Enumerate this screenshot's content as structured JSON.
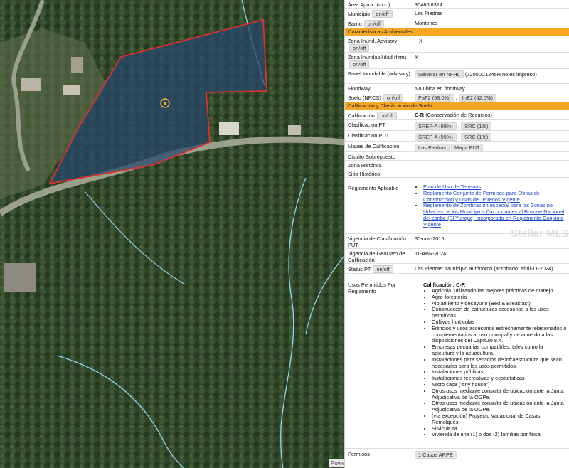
{
  "map": {
    "credit": "Powe",
    "colors": {
      "forest": "#2f4528",
      "parcel_fill": "#27466e",
      "parcel_stroke": "#e0302e",
      "stream": "#8fd6f2",
      "road": "#9aa08c"
    }
  },
  "watermark": "Stellar MLS",
  "rows": {
    "area": {
      "label": "Área Aprox. (m.c.)",
      "value": "30466.8314"
    },
    "municipio": {
      "label": "Municipio",
      "btn": "on/off",
      "value": "Las Piedras"
    },
    "barrio": {
      "label": "Barrio",
      "btn": "on/off",
      "value": "Montones"
    },
    "section_ambientales": "Características Ambientales",
    "inund_advisory": {
      "label": "Zona Inund. Advisory",
      "btn": "on/off",
      "value": "X"
    },
    "inund_firm": {
      "label": "Zona Inundabilidad (firm)",
      "btn": "on/off",
      "value": "X"
    },
    "panel_inundable": {
      "label": "Panel Inundable (advisory)",
      "btn": "Generar en NFHL",
      "value": "(72000C1245H no es impreso)"
    },
    "floodway": {
      "label": "Floodway",
      "value": "No ubica en floodway"
    },
    "suelo": {
      "label": "Suelo (NRCS)",
      "btn": "on/off",
      "tag1": "PaF2 (58.0%)",
      "sep": ",",
      "tag2": "InE2 (42.0%)"
    },
    "section_calificacion": "Calificación y Clasificación de Suelo",
    "calificacion": {
      "label": "Calificación",
      "btn": "on/off",
      "code": "C-R",
      "desc": "(Conservación de Recursos)"
    },
    "clasif_pt": {
      "label": "Clasificación PT",
      "tag1": "SREP-A (99%)",
      "sep": ",",
      "tag2": "SRC (1%)"
    },
    "clasif_put": {
      "label": "Clasificación PUT",
      "tag1": "SREP-A (99%)",
      "sep": ",",
      "tag2": "SRC (1%)"
    },
    "mapas": {
      "label": "Mapas de Calificación",
      "tag1": "Las Piedras",
      "tag2": "Mapa PUT"
    },
    "distrito": {
      "label": "Distrito Sobrepuesto"
    },
    "zona_historica": {
      "label": "Zona Histórica"
    },
    "sitio_historico": {
      "label": "Sitio Histórico"
    },
    "reglamento": {
      "label": "Reglamento Aplicable",
      "links": [
        "Plan de Uso de Terrenos",
        "Reglamento Conjunto de Permisos para Obras de Construcción y Usos de Terrenos Vigente",
        "Reglamento de Zonificación especial para las Zonas no Urbanas de los Municipios Circundantes al Bosque Nacional del caribe (El Yunque) incorporado en Reglamento Conjunto Vigente"
      ]
    },
    "vigencia_put": {
      "label": "Vigencia de Clasificación PUT",
      "value": "30-nov-2015"
    },
    "vigencia_geodato": {
      "label": "Vigencia de GeoDato de Calificación",
      "value": "11-ABR-2024"
    },
    "status_pt": {
      "label": "Status PT",
      "btn": "on/off",
      "value": "Las Piedras: Municipio autónomo (aprobado: abril-11-2024)"
    },
    "usos": {
      "label": "Usos Permitidos Por Reglamento",
      "heading": "Calificación: C-R",
      "items": [
        "Agrícola, utilizando las mejores prácticas de manejo",
        "Agro-forestería",
        "Alojamiento y desayuno (Bed & Breakfast)",
        "Construcción de estructuras accesorias a los usos permitidos.",
        "Cultivos hortícolas",
        "Edificios y usos accesorios estrechamente relacionados o complementarios al uso principal y de acuerdo a las disposiciones del Capítulo 8.4.",
        "Empresas pecuarias compatibles, tales como la apicultura y la acuacultura.",
        "Instalaciones para servicios de infraestructura que sean necesarias para los usos permitidos.",
        "Instalaciones públicas",
        "Instalaciones recreativas y ecoturísticas",
        "Micro casa (\"tiny house\")",
        "Otros usos mediante consulta de ubicación ante la Junta Adjudicativa de la OGPe.",
        "Otros usos mediante consulta de ubicación ante la Junta Adjudicativa de la OGPe.",
        "(vía excepción) Proyecto Vacacional de Casas Remolques",
        "Silvicultura",
        "Vivienda de una (1) o dos (2) familias por finca"
      ]
    },
    "permisos": {
      "label": "Permisos",
      "btn": "1 Casos ARPE"
    }
  }
}
